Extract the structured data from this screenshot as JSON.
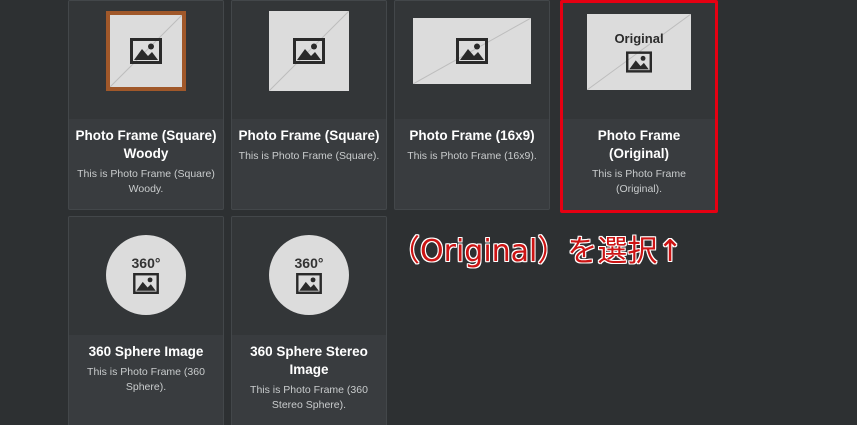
{
  "cards": [
    {
      "title": "Photo Frame (Square) Woody",
      "desc": "This is Photo Frame (Square) Woody."
    },
    {
      "title": "Photo Frame (Square)",
      "desc": "This is Photo Frame (Square)."
    },
    {
      "title": "Photo Frame (16x9)",
      "desc": "This is Photo Frame (16x9)."
    },
    {
      "title": "Photo Frame (Original)",
      "desc": "This is Photo Frame (Original).",
      "thumb_label": "Original"
    },
    {
      "title": "360 Sphere Image",
      "desc": "This is Photo Frame (360 Sphere).",
      "thumb_label": "360°"
    },
    {
      "title": "360 Sphere Stereo Image",
      "desc": "This is Photo Frame (360 Stereo Sphere).",
      "thumb_label": "360°"
    }
  ],
  "annotation": "（Original）を選択↑",
  "colors": {
    "background": "#2d3032",
    "card": "#393c3f",
    "selection": "#e60012",
    "annotation": "#cc1414",
    "woody_frame": "#a0582a"
  },
  "icons": {
    "picture": "image-icon",
    "arrow": "up-arrow"
  }
}
